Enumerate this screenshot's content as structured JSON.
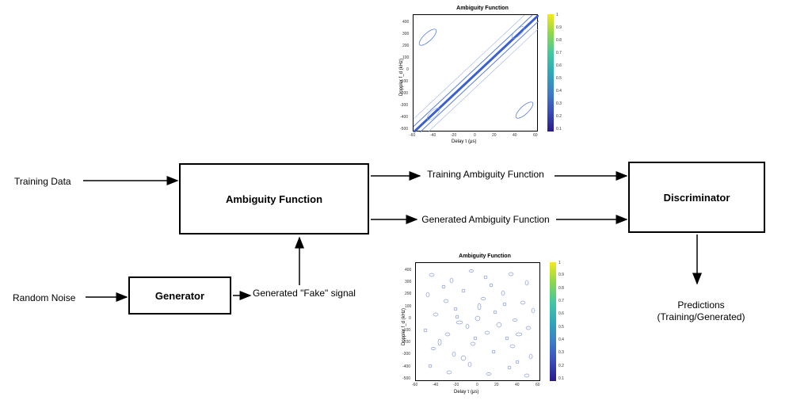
{
  "inputs": {
    "training_data": "Training Data",
    "random_noise": "Random Noise"
  },
  "blocks": {
    "generator": "Generator",
    "ambiguity": "Ambiguity Function",
    "discriminator": "Discriminator"
  },
  "edges": {
    "generated_fake_signal": "Generated \"Fake\" signal",
    "training_ambiguity": "Training Ambiguity Function",
    "generated_ambiguity": "Generated Ambiguity Function",
    "predictions": "Predictions\n(Training/Generated)"
  },
  "charts": {
    "top": {
      "title": "Ambiguity Function",
      "xlabel": "Delay τ (μs)",
      "ylabel": "Doppler f_d (kHz)",
      "xticks": [
        "-60",
        "-40",
        "-20",
        "0",
        "20",
        "40",
        "60"
      ],
      "yticks": [
        "-500",
        "-400",
        "-300",
        "-200",
        "-100",
        "0",
        "100",
        "200",
        "300",
        "400"
      ],
      "colorbar_ticks": [
        "0.1",
        "0.2",
        "0.3",
        "0.4",
        "0.5",
        "0.6",
        "0.7",
        "0.8",
        "0.9",
        "1"
      ]
    },
    "bottom": {
      "title": "Ambiguity Function",
      "xlabel": "Delay τ (μs)",
      "ylabel": "Doppler f_d (kHz)",
      "xticks": [
        "-60",
        "-40",
        "-20",
        "0",
        "20",
        "40",
        "60"
      ],
      "yticks": [
        "-500",
        "-400",
        "-300",
        "-200",
        "-100",
        "0",
        "100",
        "200",
        "300",
        "400"
      ],
      "colorbar_ticks": [
        "0.1",
        "0.2",
        "0.3",
        "0.4",
        "0.5",
        "0.6",
        "0.7",
        "0.8",
        "0.9",
        "1"
      ]
    }
  },
  "chart_data": [
    {
      "type": "heatmap",
      "title": "Ambiguity Function",
      "xlabel": "Delay τ (μs)",
      "ylabel": "Doppler f_d (kHz)",
      "xlim": [
        -60,
        60
      ],
      "ylim": [
        -500,
        500
      ],
      "colorscale_range": [
        0.1,
        1.0
      ],
      "description": "Diagonal ridge from (-60,-500) to (60,500), narrow central band with parallel sidelobes",
      "ridge_endpoints": [
        [
          -60,
          -500
        ],
        [
          60,
          500
        ]
      ]
    },
    {
      "type": "heatmap",
      "title": "Ambiguity Function",
      "xlabel": "Delay τ (μs)",
      "ylabel": "Doppler f_d (kHz)",
      "xlim": [
        -60,
        60
      ],
      "ylim": [
        -500,
        500
      ],
      "colorscale_range": [
        0.1,
        1.0
      ],
      "description": "Noise-like speckle pattern across full plane, no coherent ridge",
      "ridge_endpoints": null
    }
  ]
}
